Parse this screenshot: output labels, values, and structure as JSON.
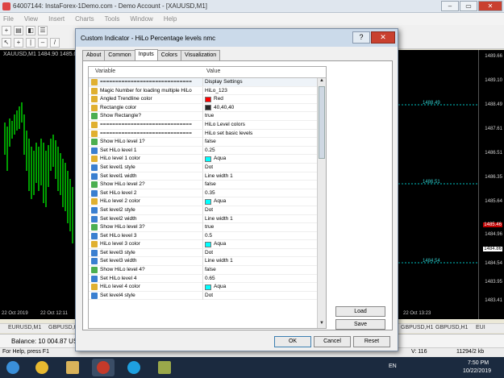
{
  "window": {
    "title": "64007144: InstaForex-1Demo.com - Demo Account - [XAUUSD,M1]",
    "min": "–",
    "max": "▭",
    "close": "✕"
  },
  "menu": [
    "File",
    "View",
    "Insert",
    "Charts",
    "Tools",
    "Window",
    "Help"
  ],
  "chart": {
    "label": "XAUUSD,M1 1484.90 1485.06",
    "prices": [
      "1489.66",
      "1489.10",
      "1488.49",
      "1487.61",
      "1486.51",
      "1486.35",
      "1485.64",
      "1484.96",
      "1484.54",
      "1483.95",
      "1483.41"
    ],
    "price_highlight": "1485.46",
    "price_white": "1484.86",
    "levels": [
      "1488.49",
      "1486.51",
      "1484.54"
    ],
    "dates": [
      "22 Oct 2019",
      "22 Oct 12:11",
      "22 Oct 13:23"
    ]
  },
  "symbol_tabs": [
    "EURUSD,M1",
    "GBPUSD,H1",
    "GBPUSD,H1",
    "GBPUSD,H1",
    "EUI"
  ],
  "balance": "Balance: 10 004.87 USD",
  "status": {
    "help": "For Help, press F1",
    "v": "V: 116",
    "kb": "11294/2 kb"
  },
  "taskbar": {
    "lang": "EN",
    "time": "7:50 PM",
    "date": "10/22/2019"
  },
  "dialog": {
    "title": "Custom Indicator - HiLo Percentage levels nmc",
    "help": "?",
    "close": "✕",
    "tabs": [
      "About",
      "Common",
      "Inputs",
      "Colors",
      "Visualization"
    ],
    "active_tab": "Inputs",
    "col_variable": "Variable",
    "col_value": "Value",
    "rows": [
      {
        "v": "==============================",
        "val": "Display Settings",
        "t": "ab"
      },
      {
        "v": "Magic Number for loading multiple HiLo",
        "val": "HiLo_123",
        "t": "ab"
      },
      {
        "v": "Angled Trendline color",
        "val": "Red",
        "t": "color",
        "c": "#ff0000"
      },
      {
        "v": "Rectangle color",
        "val": "40,40,40",
        "t": "color",
        "c": "#282828"
      },
      {
        "v": "Show Rectangle?",
        "val": "true",
        "t": "bool"
      },
      {
        "v": "==============================",
        "val": "HiLo Level colors",
        "t": "ab"
      },
      {
        "v": "==============================",
        "val": "HiLo set basic levels",
        "t": "ab"
      },
      {
        "v": "Show HiLo level 1?",
        "val": "false",
        "t": "bool"
      },
      {
        "v": "Set HiLo level 1",
        "val": "0.25",
        "t": "num"
      },
      {
        "v": "HiLo level 1 color",
        "val": "Aqua",
        "t": "color",
        "c": "#00ffff"
      },
      {
        "v": "Set level1 style",
        "val": "Dot",
        "t": "enum"
      },
      {
        "v": "Set level1 width",
        "val": "Line width 1",
        "t": "enum"
      },
      {
        "v": "Show HiLo level 2?",
        "val": "false",
        "t": "bool"
      },
      {
        "v": "Set HiLo level 2",
        "val": "0.35",
        "t": "num"
      },
      {
        "v": "HiLo level 2 color",
        "val": "Aqua",
        "t": "color",
        "c": "#00ffff"
      },
      {
        "v": "Set level2 style",
        "val": "Dot",
        "t": "enum"
      },
      {
        "v": "Set level2 width",
        "val": "Line width 1",
        "t": "enum"
      },
      {
        "v": "Show HiLo level 3?",
        "val": "true",
        "t": "bool"
      },
      {
        "v": "Set HiLo level 3",
        "val": "0.5",
        "t": "num"
      },
      {
        "v": "HiLo level 3 color",
        "val": "Aqua",
        "t": "color",
        "c": "#00ffff"
      },
      {
        "v": "Set level3 style",
        "val": "Dot",
        "t": "enum"
      },
      {
        "v": "Set level3 width",
        "val": "Line width 1",
        "t": "enum"
      },
      {
        "v": "Show HiLo level 4?",
        "val": "false",
        "t": "bool"
      },
      {
        "v": "Set HiLo level 4",
        "val": "0.65",
        "t": "num"
      },
      {
        "v": "HiLo level 4 color",
        "val": "Aqua",
        "t": "color",
        "c": "#00ffff"
      },
      {
        "v": "Set level4 style",
        "val": "Dot",
        "t": "enum"
      }
    ],
    "icon_colors": {
      "ab": "#e0b030",
      "bool": "#4caf50",
      "num": "#3a7fd0",
      "enum": "#3a7fd0",
      "color": "#e0b030"
    },
    "load": "Load",
    "save": "Save",
    "ok": "OK",
    "cancel": "Cancel",
    "reset": "Reset"
  }
}
